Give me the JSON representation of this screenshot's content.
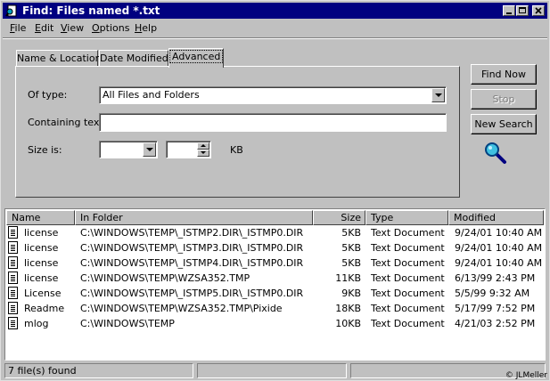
{
  "window": {
    "title": "Find: Files named *.txt",
    "controls": {
      "minimize": "minimize-icon",
      "maximize": "maximize-icon",
      "close": "close-icon"
    }
  },
  "menu": [
    {
      "label": "File",
      "underline": "F",
      "rest": "ile"
    },
    {
      "label": "Edit",
      "underline": "E",
      "rest": "dit"
    },
    {
      "label": "View",
      "underline": "V",
      "rest": "iew"
    },
    {
      "label": "Options",
      "underline": "O",
      "rest": "ptions"
    },
    {
      "label": "Help",
      "underline": "H",
      "rest": "elp"
    }
  ],
  "tabs": {
    "name_location": "Name & Location",
    "date_modified": "Date Modified",
    "advanced": "Advanced",
    "active": "advanced"
  },
  "form": {
    "of_type_label": "Of type:",
    "of_type_value": "All Files and Folders",
    "containing_text_label": "Containing text:",
    "containing_text_value": "",
    "size_is_label": "Size is:",
    "size_is_value": "",
    "size_amount": "",
    "size_unit": "KB"
  },
  "buttons": {
    "find_now": "Find Now",
    "stop": "Stop",
    "new_search": "New Search"
  },
  "results": {
    "columns": [
      "Name",
      "In Folder",
      "Size",
      "Type",
      "Modified"
    ],
    "rows": [
      [
        "license",
        "C:\\WINDOWS\\TEMP\\_ISTMP2.DIR\\_ISTMP0.DIR",
        "5KB",
        "Text Document",
        "9/24/01 10:40 AM"
      ],
      [
        "license",
        "C:\\WINDOWS\\TEMP\\_ISTMP3.DIR\\_ISTMP0.DIR",
        "5KB",
        "Text Document",
        "9/24/01 10:40 AM"
      ],
      [
        "license",
        "C:\\WINDOWS\\TEMP\\_ISTMP4.DIR\\_ISTMP0.DIR",
        "5KB",
        "Text Document",
        "9/24/01 10:40 AM"
      ],
      [
        "license",
        "C:\\WINDOWS\\TEMP\\WZSA352.TMP",
        "11KB",
        "Text Document",
        "6/13/99 2:43 PM"
      ],
      [
        "License",
        "C:\\WINDOWS\\TEMP\\_ISTMP5.DIR\\_ISTMP0.DIR",
        "9KB",
        "Text Document",
        "5/5/99 9:32 AM"
      ],
      [
        "Readme",
        "C:\\WINDOWS\\TEMP\\WZSA352.TMP\\Pixide",
        "18KB",
        "Text Document",
        "5/17/99 7:52 PM"
      ],
      [
        "mlog",
        "C:\\WINDOWS\\TEMP",
        "10KB",
        "Text Document",
        "4/21/03 2:52 PM"
      ]
    ]
  },
  "status": {
    "found": "7 file(s) found",
    "credit": "© JLMeller"
  }
}
